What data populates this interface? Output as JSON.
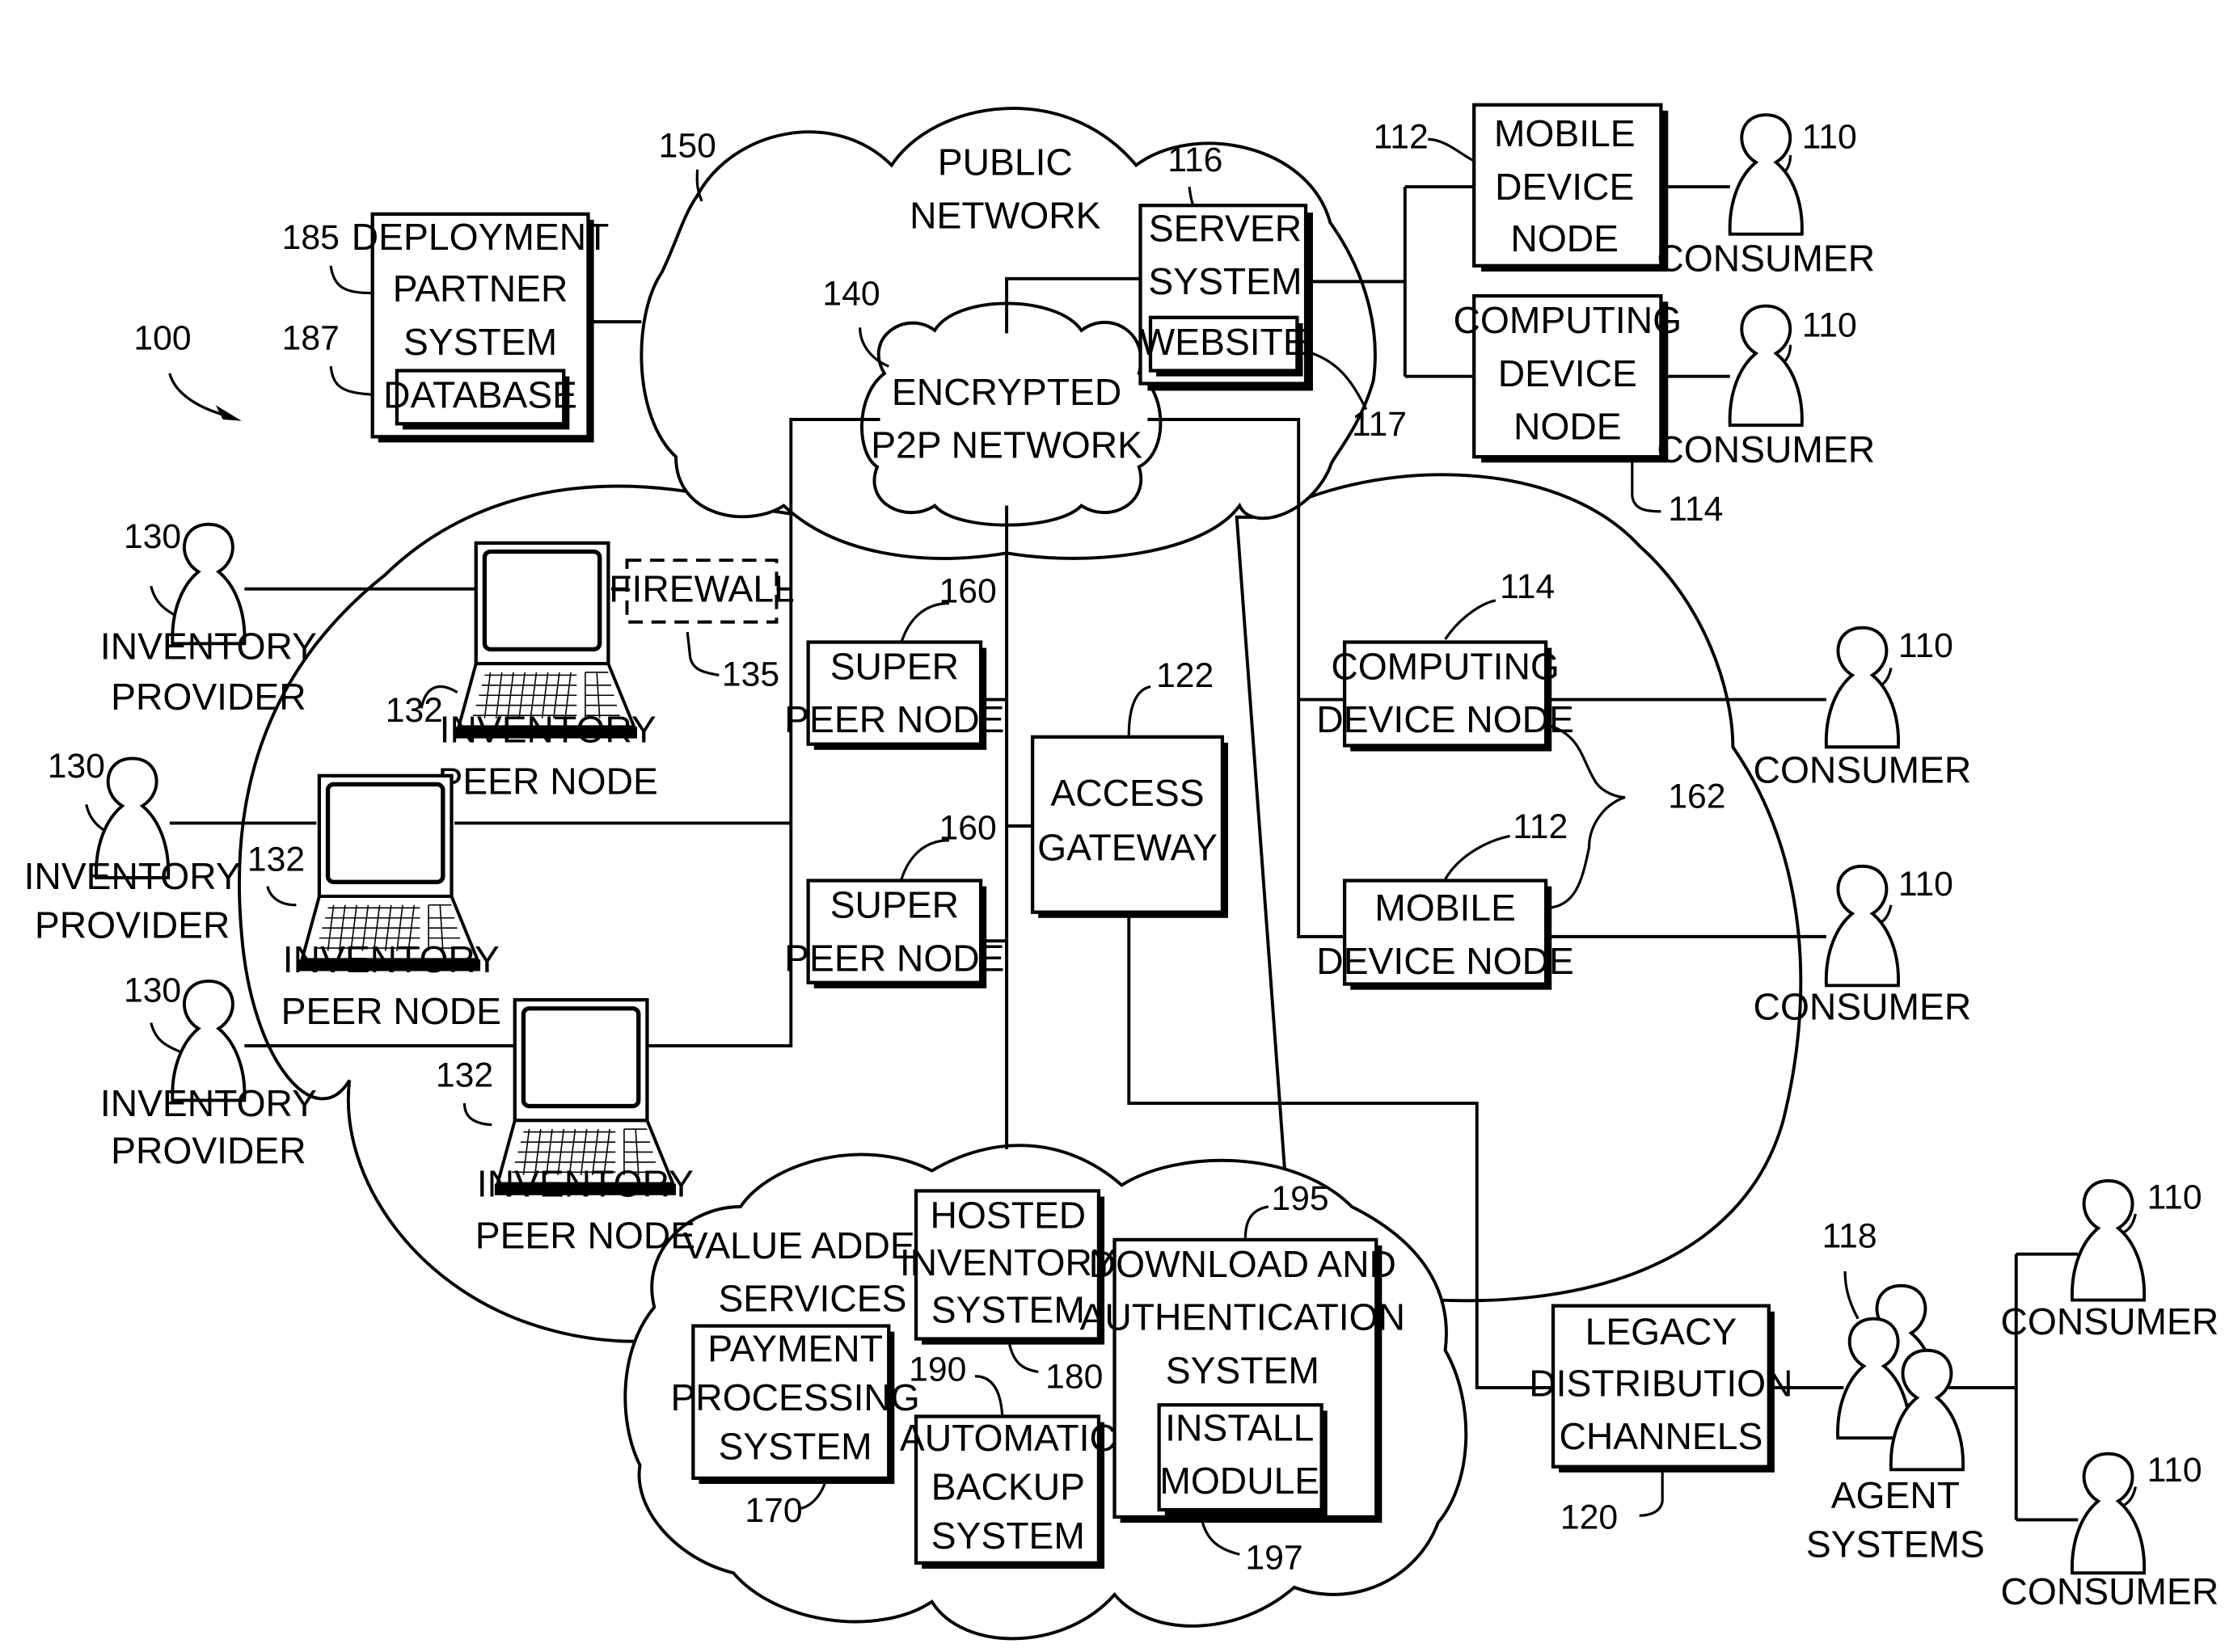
{
  "figure": {
    "ref_system": "100",
    "colors": {
      "line": "#000000",
      "background": "#ffffff"
    }
  },
  "public_network": {
    "ref": "150",
    "label_line1": "PUBLIC",
    "label_line2": "NETWORK"
  },
  "encrypted_network": {
    "ref": "140",
    "label_line1": "ENCRYPTED",
    "label_line2": "P2P NETWORK"
  },
  "server_system": {
    "ref": "116",
    "label_line1": "SERVER",
    "label_line2": "SYSTEM",
    "website": {
      "ref": "117",
      "label": "WEBSITE"
    }
  },
  "deployment_partner": {
    "ref": "185",
    "label_line1": "DEPLOYMENT",
    "label_line2": "PARTNER",
    "label_line3": "SYSTEM",
    "database": {
      "ref": "187",
      "label": "DATABASE"
    }
  },
  "top_right_nodes": {
    "mobile": {
      "ref": "112",
      "label_line1": "MOBILE",
      "label_line2": "DEVICE",
      "label_line3": "NODE"
    },
    "computing": {
      "ref": "114",
      "label_line1": "COMPUTING",
      "label_line2": "DEVICE",
      "label_line3": "NODE"
    }
  },
  "consumer": {
    "ref": "110",
    "label": "CONSUMER"
  },
  "inventory": {
    "provider": {
      "ref": "130",
      "label_line1": "INVENTORY",
      "label_line2": "PROVIDER"
    },
    "peer_node": {
      "ref": "132",
      "label_line1": "INVENTORY",
      "label_line2": "PEER NODE"
    },
    "firewall": {
      "ref": "135",
      "label": "FIREWALL"
    }
  },
  "super_peer": {
    "ref": "160",
    "label_line1": "SUPER",
    "label_line2": "PEER NODE"
  },
  "access_gateway": {
    "ref": "122",
    "label_line1": "ACCESS",
    "label_line2": "GATEWAY"
  },
  "right_cloud": {
    "group_ref": "162",
    "computing": {
      "ref": "114",
      "label_line1": "COMPUTING",
      "label_line2": "DEVICE NODE"
    },
    "mobile": {
      "ref": "112",
      "label_line1": "MOBILE",
      "label_line2": "DEVICE NODE"
    }
  },
  "value_added": {
    "label_line1": "VALUE ADDED",
    "label_line2": "SERVICES",
    "payment": {
      "ref": "170",
      "label_line1": "PAYMENT",
      "label_line2": "PROCESSING",
      "label_line3": "SYSTEM"
    },
    "hosted": {
      "ref": "180",
      "label_line1": "HOSTED",
      "label_line2": "INVENTORY",
      "label_line3": "SYSTEM"
    },
    "backup": {
      "ref": "190",
      "label_line1": "AUTOMATIC",
      "label_line2": "BACKUP",
      "label_line3": "SYSTEM"
    },
    "download": {
      "ref": "195",
      "label_line1": "DOWNLOAD AND",
      "label_line2": "AUTHENTICATION",
      "label_line3": "SYSTEM",
      "install": {
        "ref": "197",
        "label_line1": "INSTALL",
        "label_line2": "MODULE"
      }
    }
  },
  "legacy": {
    "ref": "120",
    "label_line1": "LEGACY",
    "label_line2": "DISTRIBUTION",
    "label_line3": "CHANNELS"
  },
  "agents": {
    "ref": "118",
    "label_line1": "AGENT",
    "label_line2": "SYSTEMS"
  }
}
